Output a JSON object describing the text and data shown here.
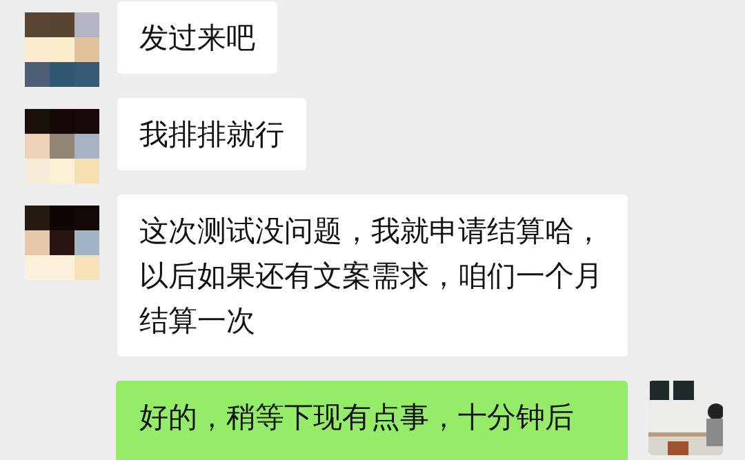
{
  "messages": [
    {
      "kind": "received",
      "text": "发过来吧"
    },
    {
      "kind": "received",
      "text": "我排排就行"
    },
    {
      "kind": "received",
      "text": "这次测试没问题，我就申请结算哈，以后如果还有文案需求，咱们一个月结算一次"
    },
    {
      "kind": "sent",
      "text": "好的，稍等下现有点事，十分钟后"
    }
  ]
}
